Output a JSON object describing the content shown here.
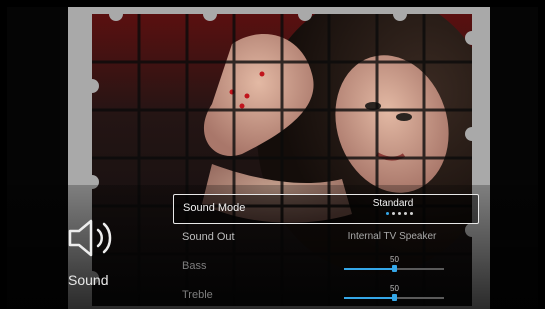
{
  "panel": {
    "title": "Sound",
    "icon": "speaker-icon"
  },
  "menu": {
    "items": [
      {
        "label": "Sound Mode",
        "value": "Standard",
        "selected": true,
        "option_count": 5,
        "option_index": 0
      },
      {
        "label": "Sound Out",
        "value": "Internal TV Speaker"
      },
      {
        "label": "Bass",
        "value": "50",
        "level": 0.5
      },
      {
        "label": "Treble",
        "value": "50",
        "level": 0.5
      }
    ]
  },
  "colors": {
    "accent": "#35a7e8",
    "text": "#f0f0f0",
    "dim_text": "#a9a9a9",
    "backdrop": "#a9a9a9"
  }
}
